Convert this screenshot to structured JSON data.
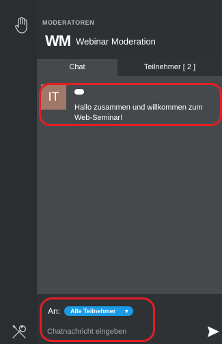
{
  "header": {
    "section_label": "MODERATOREN",
    "logo_text": "WM",
    "title": "Webinar Moderation"
  },
  "tabs": [
    {
      "label": "Chat",
      "active": true
    },
    {
      "label": "Teilnehmer [ 2 ]",
      "active": false
    }
  ],
  "messages": [
    {
      "avatar_initials": "IT",
      "avatar_color": "#a07868",
      "sender": "",
      "text": "Hallo zusammen und willkommen zum Web-Seminar!"
    }
  ],
  "composer": {
    "to_label": "An:",
    "recipient": "Alle Teilnehmer",
    "placeholder": "Chatnachricht eingeben"
  },
  "icons": {
    "left_top": "raised-hand-icon",
    "left_bottom": "tools-icon",
    "send": "send-icon",
    "dropdown": "caret-down-icon"
  },
  "colors": {
    "accent": "#1a9be6",
    "highlight": "#e31e24",
    "chat_background": "#45494c",
    "panel_background": "#2e3134"
  }
}
